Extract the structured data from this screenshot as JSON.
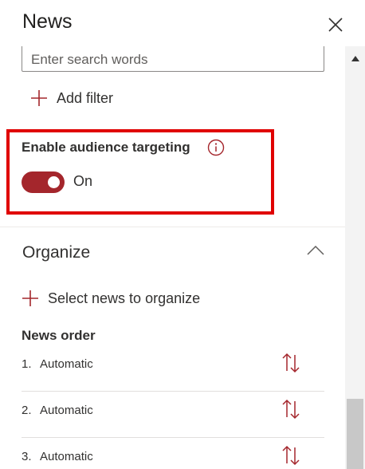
{
  "panel": {
    "title": "News"
  },
  "search": {
    "placeholder": "Enter search words",
    "value": ""
  },
  "filter": {
    "add_label": "Add filter"
  },
  "audience": {
    "label": "Enable audience targeting",
    "toggle_state": "On",
    "enabled": true
  },
  "organize": {
    "title": "Organize",
    "select_label": "Select news to organize",
    "order_heading": "News order",
    "items": [
      {
        "number": "1.",
        "label": "Automatic"
      },
      {
        "number": "2.",
        "label": "Automatic"
      },
      {
        "number": "3.",
        "label": "Automatic"
      }
    ]
  },
  "colors": {
    "accent": "#a4262c",
    "highlight": "#e00000"
  },
  "icons": [
    "close-icon",
    "plus-icon",
    "info-icon",
    "chevron-up-icon",
    "sort-arrows-icon"
  ]
}
